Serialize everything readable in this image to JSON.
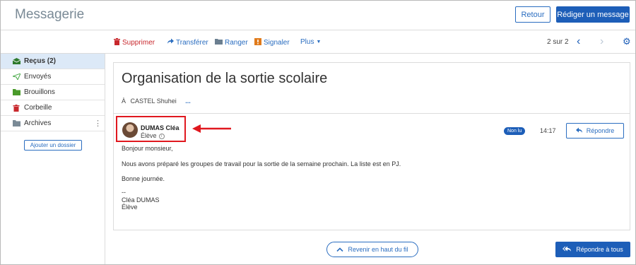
{
  "app": {
    "title": "Messagerie"
  },
  "header": {
    "back_label": "Retour",
    "compose_label": "Rédiger un message"
  },
  "toolbar": {
    "delete_label": "Supprimer",
    "forward_label": "Transférer",
    "archive_label": "Ranger",
    "report_label": "Signaler",
    "more_label": "Plus",
    "pager": "2 sur 2"
  },
  "sidebar": {
    "items": [
      {
        "label": "Reçus (2)",
        "icon": "inbox-icon",
        "color": "#3a8a3a"
      },
      {
        "label": "Envoyés",
        "icon": "send-icon",
        "color": "#4aaa4a"
      },
      {
        "label": "Brouillons",
        "icon": "folder-icon",
        "color": "#4a9a2a"
      },
      {
        "label": "Corbeille",
        "icon": "trash-icon",
        "color": "#c8282d"
      },
      {
        "label": "Archives",
        "icon": "folder-icon",
        "color": "#7a8a96"
      }
    ],
    "add_folder_label": "Ajouter un dossier"
  },
  "thread": {
    "subject": "Organisation de la sortie scolaire",
    "to_label": "À",
    "recipient": "CASTEL Shuhei",
    "more_recipients": "..."
  },
  "message": {
    "sender_name": "DUMAS Cléa",
    "sender_role": "Élève",
    "status_badge": "Non lu",
    "time": "14:17",
    "reply_label": "Répondre",
    "body": [
      "Bonjour monsieur,",
      "Nous avons préparé les groupes de travail pour la sortie de la semaine prochain. La liste est en PJ.",
      "Bonne journée.",
      "--",
      "Cléa DUMAS",
      "Élève"
    ]
  },
  "footer": {
    "back_to_top_label": "Revenir en haut du fil",
    "reply_all_label": "Répondre à tous"
  },
  "colors": {
    "primary": "#1d5eb8",
    "danger": "#c8282d",
    "highlight": "#e0181f"
  }
}
